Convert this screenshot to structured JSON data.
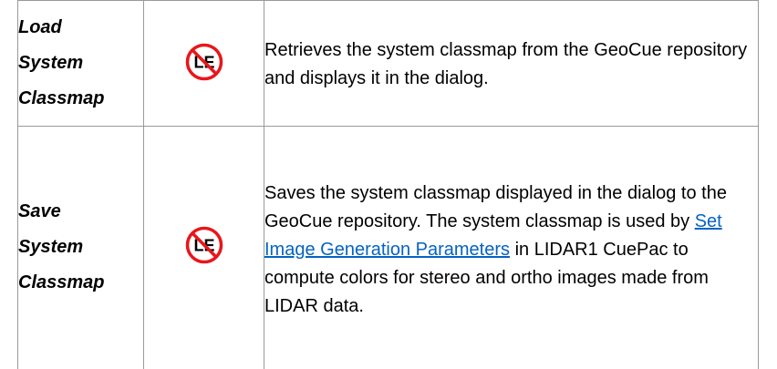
{
  "rows": [
    {
      "name_lines": [
        "Load",
        "System",
        "Classmap"
      ],
      "icon": "no-le-icon",
      "description": "Retrieves the system classmap from the GeoCue repository and displays it in the dialog."
    },
    {
      "name_lines": [
        "Save",
        "System",
        "Classmap"
      ],
      "icon": "no-le-icon",
      "description_before": "Saves the system classmap displayed in the dialog to the GeoCue repository. The system classmap is used by ",
      "link_text": "Set Image Generation Parameters",
      "description_after": " in LIDAR1 CuePac to compute colors for stereo and ortho images made from LIDAR data."
    }
  ],
  "icon_letters": "LE",
  "colors": {
    "icon_ring": "#e8161b",
    "link": "#0563c1",
    "border": "#9a9a9a"
  }
}
